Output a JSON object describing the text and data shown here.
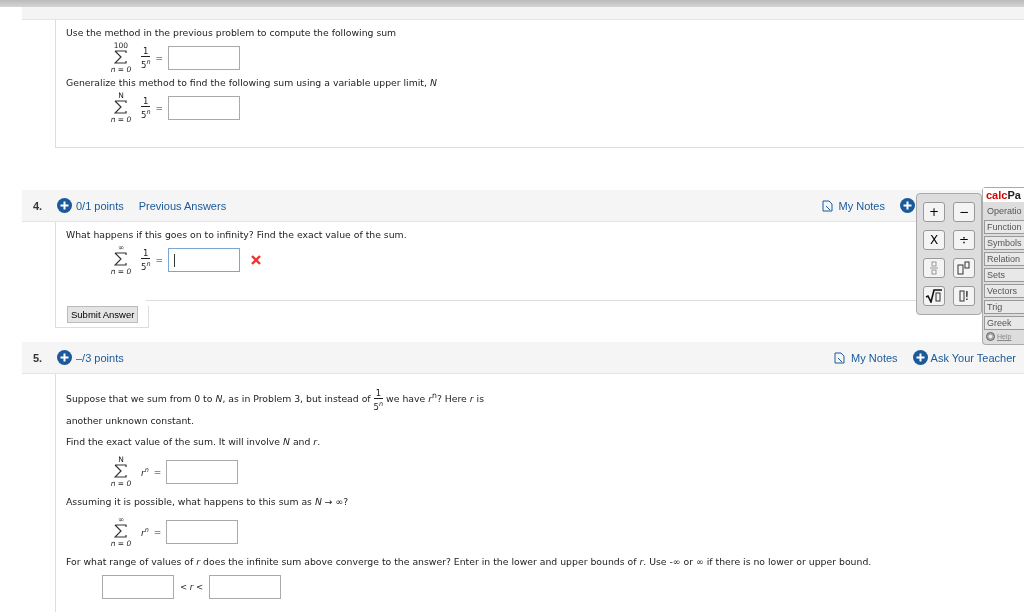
{
  "previous_part": {
    "blocks": [
      {
        "kind": "text",
        "text": "Use the method in the previous problem to compute the following sum"
      },
      {
        "kind": "sum",
        "upper": "100",
        "lower": "n = 0",
        "summand": {
          "kind": "fraction",
          "num": "1",
          "base": "5",
          "exp": "n"
        },
        "eq": "=",
        "answer": {
          "focused": false
        }
      },
      {
        "kind": "text",
        "text": "Generalize this method to find the following sum using a variable upper limit, *N*"
      },
      {
        "kind": "sum",
        "upper": "N",
        "lower": "n = 0",
        "summand": {
          "kind": "fraction",
          "num": "1",
          "base": "5",
          "exp": "n"
        },
        "eq": "=",
        "answer": {
          "focused": false
        }
      }
    ]
  },
  "questions": [
    {
      "number": "4.",
      "points": "0/1 points",
      "previous_answers": "Previous Answers",
      "notes": "My Notes",
      "blocks": [
        {
          "kind": "text",
          "text": "What happens if this goes on to infinity? Find the exact value of the sum."
        },
        {
          "kind": "sum",
          "upper": "∞",
          "lower": "n = 0",
          "summand": {
            "kind": "fraction",
            "num": "1",
            "base": "5",
            "exp": "n"
          },
          "eq": "=",
          "answer": {
            "focused": true,
            "wrong": true
          }
        }
      ],
      "submit": "Submit Answer"
    },
    {
      "number": "5.",
      "points": "–/3 points",
      "notes": "My Notes",
      "ask": "Ask Your Teacher",
      "blocks": [
        {
          "kind": "inline_fraction",
          "before": "Suppose that we sum from 0 to *N*, as in Problem 3, but instead of",
          "num": "1",
          "base": "5",
          "exp": "n",
          "after": "we have *r*$^{n}$?  Here *r* is another unknown constant."
        },
        {
          "kind": "text",
          "text": "Find the exact value of the sum. It will involve *N* and *r*."
        },
        {
          "kind": "sum",
          "upper": "N",
          "lower": "n = 0",
          "summand": {
            "kind": "power",
            "base": "r",
            "exp": "n"
          },
          "eq": "=",
          "answer": {
            "focused": false
          }
        },
        {
          "kind": "text",
          "text": "Assuming it is possible, what happens to this sum as *N* → ∞?"
        },
        {
          "kind": "sum",
          "upper": "∞",
          "lower": "n = 0",
          "summand": {
            "kind": "power",
            "base": "r",
            "exp": "n"
          },
          "eq": "=",
          "answer": {
            "focused": false
          }
        },
        {
          "kind": "text",
          "text": "For what range of values of *r* does the infinite sum above converge to the answer? Enter in the lower and upper bounds of *r*. Use -∞ or ∞ if there is no lower or upper bound."
        },
        {
          "kind": "range",
          "middle": "< *r* <"
        }
      ]
    }
  ],
  "calcpad": {
    "brand_red": "calc",
    "brand_rest": "Pa",
    "keys": [
      {
        "kind": "text",
        "label": "+"
      },
      {
        "kind": "text",
        "label": "−"
      },
      {
        "kind": "text",
        "label": "X"
      },
      {
        "kind": "text",
        "label": "÷"
      },
      {
        "kind": "fraction"
      },
      {
        "kind": "power"
      },
      {
        "kind": "sqrt"
      },
      {
        "kind": "factorial",
        "label": "!"
      }
    ],
    "categories": [
      {
        "label": "Operatio",
        "selected": true
      },
      {
        "label": "Function",
        "selected": false
      },
      {
        "label": "Symbols",
        "selected": false
      },
      {
        "label": "Relation",
        "selected": false
      },
      {
        "label": "Sets",
        "selected": false
      },
      {
        "label": "Vectors",
        "selected": false
      },
      {
        "label": "Trig",
        "selected": false
      },
      {
        "label": "Greek",
        "selected": false
      }
    ],
    "help": "Help"
  }
}
